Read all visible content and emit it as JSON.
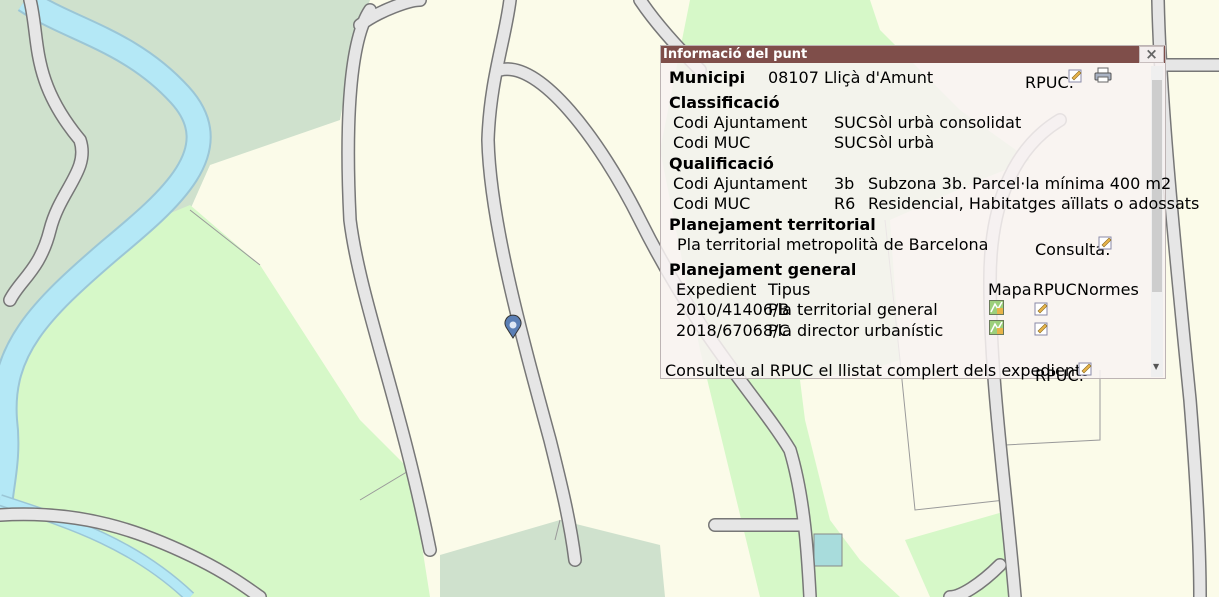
{
  "popup": {
    "title": "Informació del punt",
    "close_icon": "close-icon",
    "municipi": {
      "label": "Municipi",
      "value": "08107 Lliçà d'Amunt",
      "rpuc_label": "RPUC:",
      "icons": [
        "edit-icon",
        "print-icon"
      ]
    },
    "classificacio": {
      "heading": "Classificació",
      "rows": [
        {
          "label": "Codi Ajuntament",
          "code": "SUC",
          "desc": "Sòl urbà consolidat"
        },
        {
          "label": "Codi MUC",
          "code": "SUC",
          "desc": "Sòl urbà"
        }
      ]
    },
    "qualificacio": {
      "heading": "Qualificació",
      "rows": [
        {
          "label": "Codi Ajuntament",
          "code": "3b",
          "desc": "Subzona 3b. Parcel·la mínima 400 m2"
        },
        {
          "label": "Codi MUC",
          "code": "R6",
          "desc": "Residencial, Habitatges aïllats o adossats"
        }
      ]
    },
    "territorial": {
      "heading": "Planejament territorial",
      "item": "Pla territorial metropolità de Barcelona",
      "consulta_label": "Consulta:"
    },
    "general": {
      "heading": "Planejament general",
      "columns": [
        "Expedient",
        "Tipus",
        "Mapa",
        "RPUC",
        "Normes"
      ],
      "rows": [
        {
          "expedient": "2010/41406/B",
          "tipus": "Pla territorial general"
        },
        {
          "expedient": "2018/67068/C",
          "tipus": "Pla director urbanístic"
        }
      ]
    },
    "footer": {
      "text": "Consulteu al RPUC el llistat complert dels expedients",
      "rpuc_label": "RPUC:"
    }
  },
  "map": {
    "colors": {
      "urban": "#fbfbe9",
      "green": "#d6f8c8",
      "forest": "#cfe1cd",
      "river": "#b4e8f6",
      "road": "#e6e6e6",
      "road_edge": "#777777",
      "water_small": "#a8dcdc",
      "marker": "#5b7fb5"
    },
    "marker_icon": "location-pin-icon"
  }
}
